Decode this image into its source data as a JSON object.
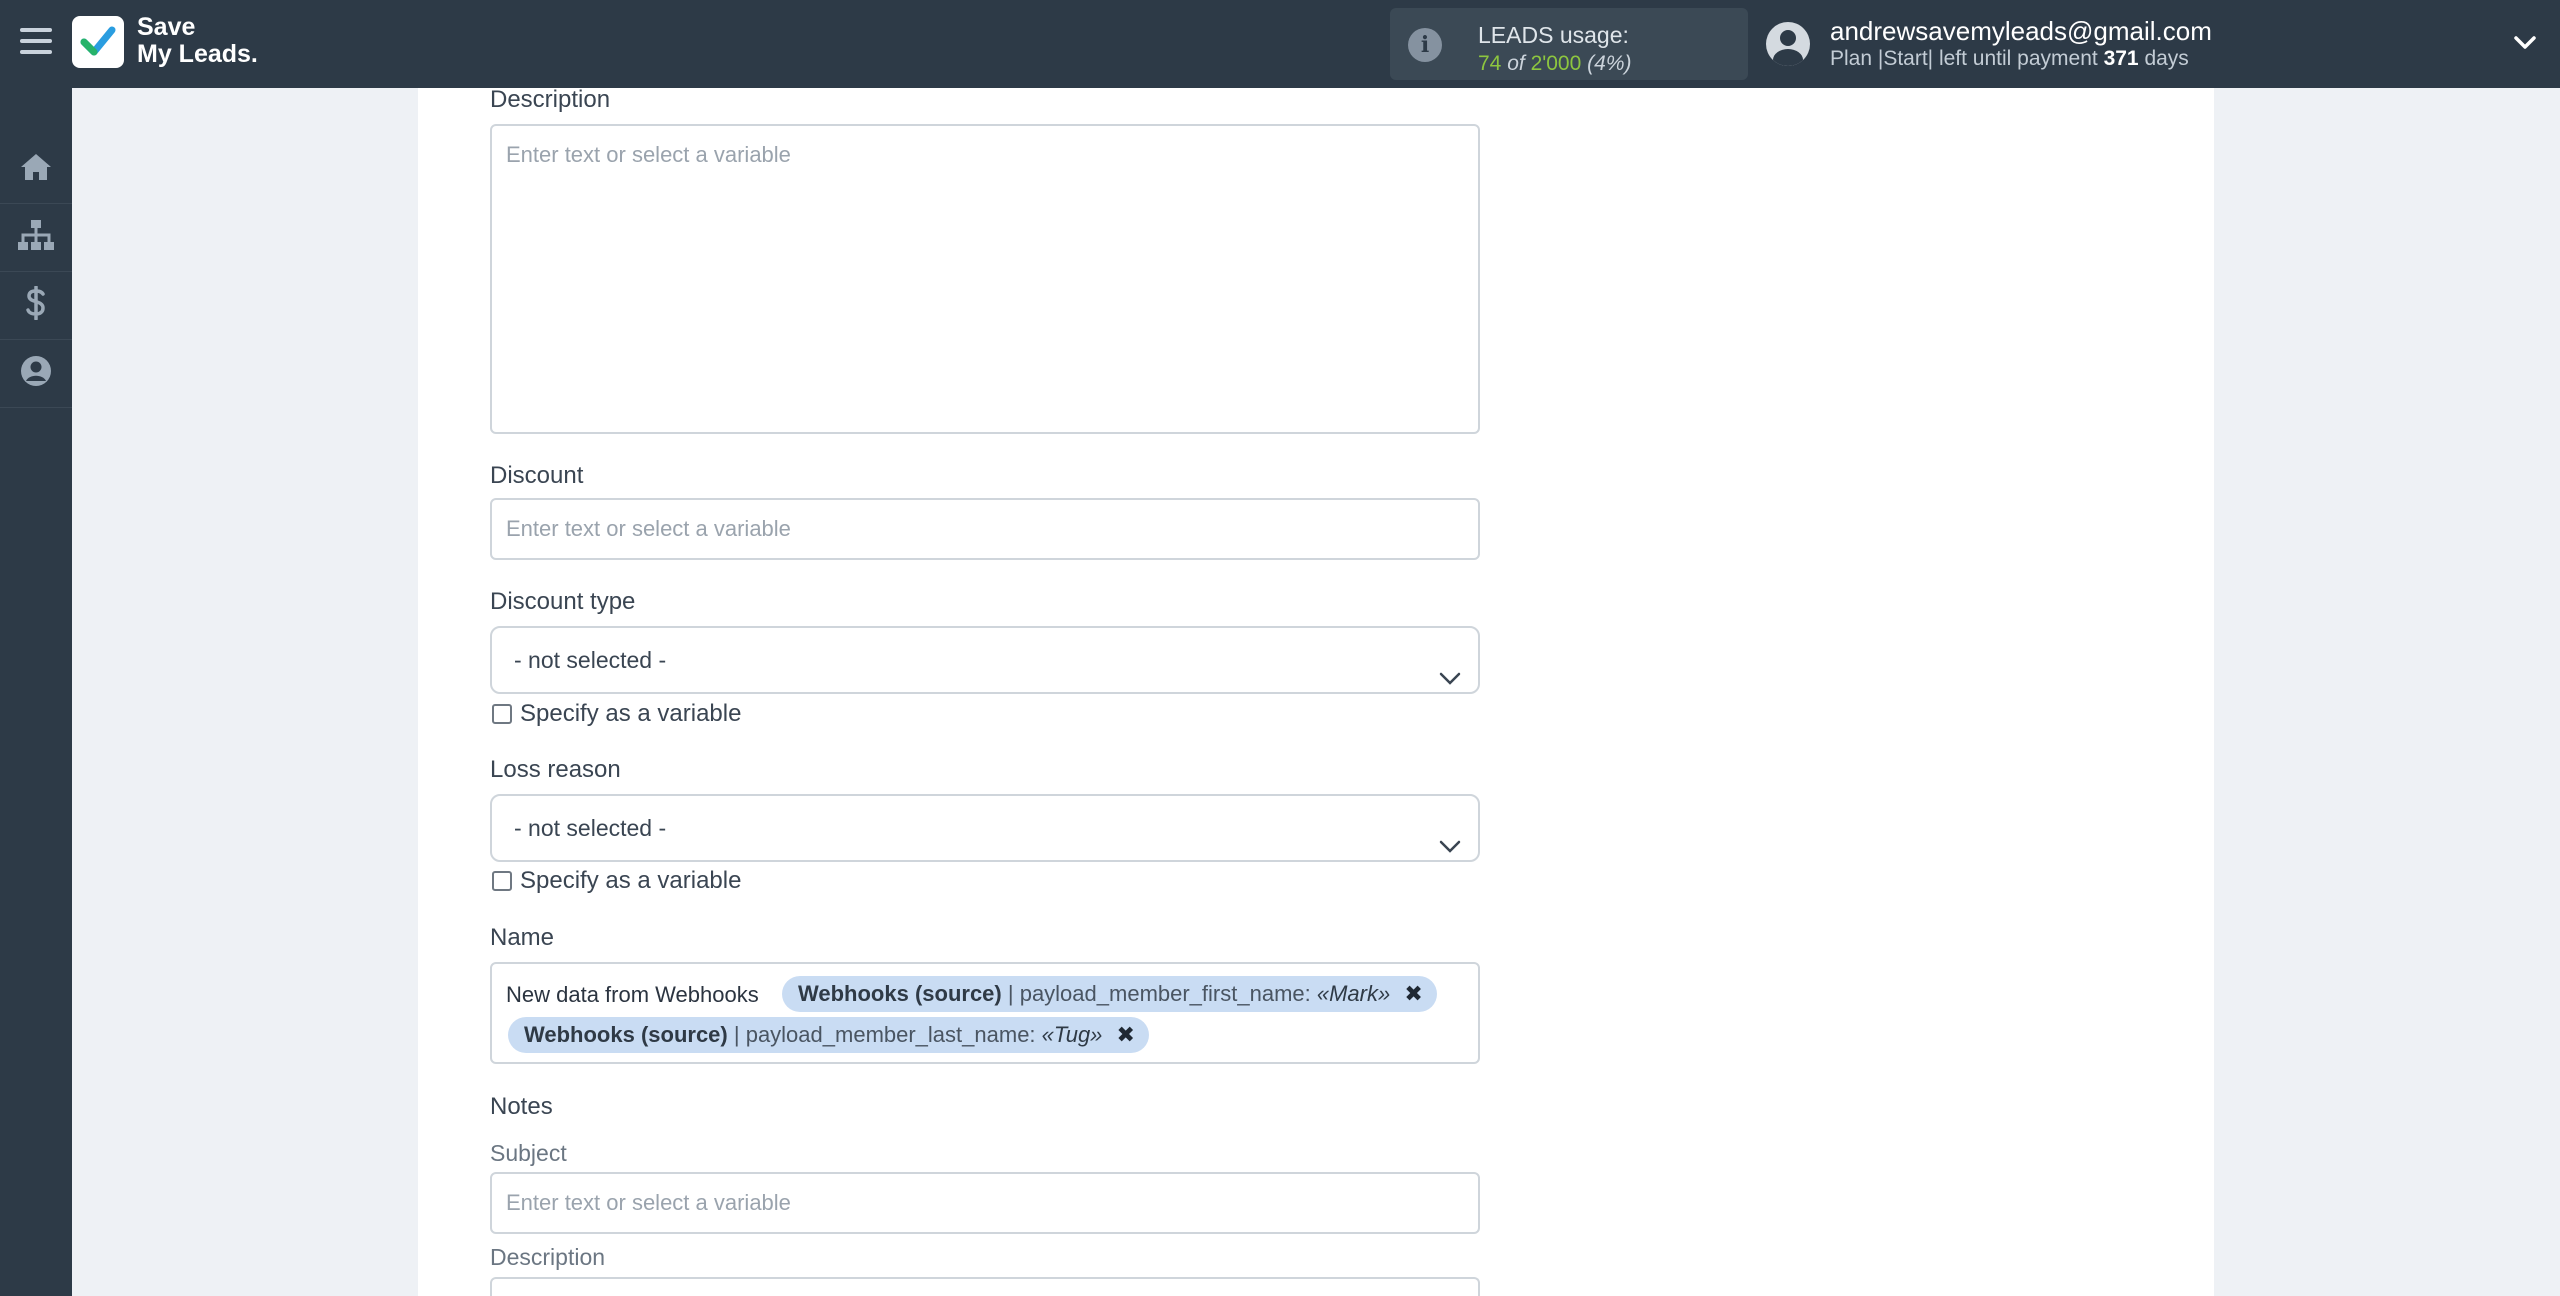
{
  "brand": {
    "line1": "Save",
    "line2": "My Leads."
  },
  "usage": {
    "title": "LEADS usage:",
    "used": "74",
    "of_label": "of",
    "total": "2'000",
    "percent": "(4%)",
    "info_icon": "i"
  },
  "account": {
    "email": "andrewsavemyleads@gmail.com",
    "plan_prefix": "Plan |Start| left until payment",
    "days": "371",
    "days_suffix": "days"
  },
  "sidebar": {
    "items": [
      {
        "icon": "home-icon"
      },
      {
        "icon": "sitemap-icon"
      },
      {
        "icon": "dollar-icon"
      },
      {
        "icon": "user-circle-icon"
      }
    ]
  },
  "form": {
    "description": {
      "label": "Description",
      "placeholder": "Enter text or select a variable"
    },
    "discount": {
      "label": "Discount",
      "placeholder": "Enter text or select a variable"
    },
    "discount_type": {
      "label": "Discount type",
      "value": "- not selected -",
      "checkbox": "Specify as a variable"
    },
    "loss_reason": {
      "label": "Loss reason",
      "value": "- not selected -",
      "checkbox": "Specify as a variable"
    },
    "name": {
      "label": "Name",
      "static_text": "New data from Webhooks",
      "tags": [
        {
          "source": "Webhooks (source)",
          "field": "| payload_member_first_name:",
          "value": "«Mark»",
          "remove": "✖"
        },
        {
          "source": "Webhooks (source)",
          "field": "| payload_member_last_name:",
          "value": "«Tug»",
          "remove": "✖"
        }
      ]
    },
    "notes": {
      "label": "Notes",
      "subject": {
        "label": "Subject",
        "placeholder": "Enter text or select a variable"
      },
      "description": {
        "label": "Description"
      }
    }
  },
  "colors": {
    "topbar": "#2d3a47",
    "accent_green": "#8dc63f",
    "tag_bg": "#c9dcf3",
    "page_bg": "#eef1f5"
  }
}
